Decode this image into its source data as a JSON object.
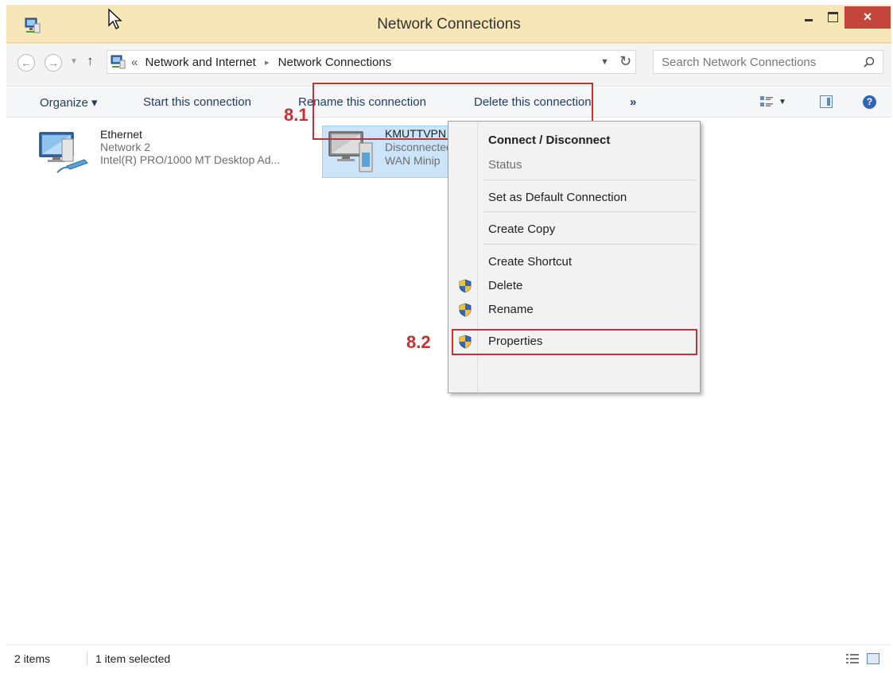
{
  "window": {
    "title": "Network Connections",
    "close_glyph": "×"
  },
  "nav": {
    "back_glyph": "←",
    "forward_glyph": "→",
    "up_glyph": "↑",
    "breadcrumb_prefix": "«",
    "breadcrumbs": [
      "Network and Internet",
      "Network Connections"
    ],
    "breadcrumb_separator": "▸",
    "refresh_glyph": "↻",
    "search_placeholder": "Search Network Connections"
  },
  "toolbar": {
    "organize": "Organize ▾",
    "start": "Start this connection",
    "rename": "Rename this connection",
    "delete": "Delete this connection",
    "more": "»"
  },
  "connections": [
    {
      "name": "Ethernet",
      "network": "Network 2",
      "device": "Intel(R) PRO/1000 MT Desktop Ad..."
    },
    {
      "name": "KMUTTVPN",
      "status": "Disconnected",
      "device": "WAN Minip"
    }
  ],
  "callouts": {
    "step1": "8.1",
    "step2": "8.2"
  },
  "context_menu": {
    "items": [
      {
        "label": "Connect / Disconnect",
        "style": "default"
      },
      {
        "label": "Status",
        "style": "disabled"
      },
      {
        "label": "Set as Default Connection"
      },
      {
        "label": "Create Copy"
      },
      {
        "label": "Create Shortcut"
      },
      {
        "label": "Delete",
        "icon": "uac-shield-icon"
      },
      {
        "label": "Rename",
        "icon": "uac-shield-icon"
      },
      {
        "label": "Properties",
        "icon": "uac-shield-icon"
      }
    ]
  },
  "status": {
    "count": "2 items",
    "selected": "1 item selected"
  },
  "colors": {
    "selection": "#cce4f7",
    "callout": "#c23234",
    "close_button": "#c4453c",
    "titlebar": "#f7e6b8"
  }
}
